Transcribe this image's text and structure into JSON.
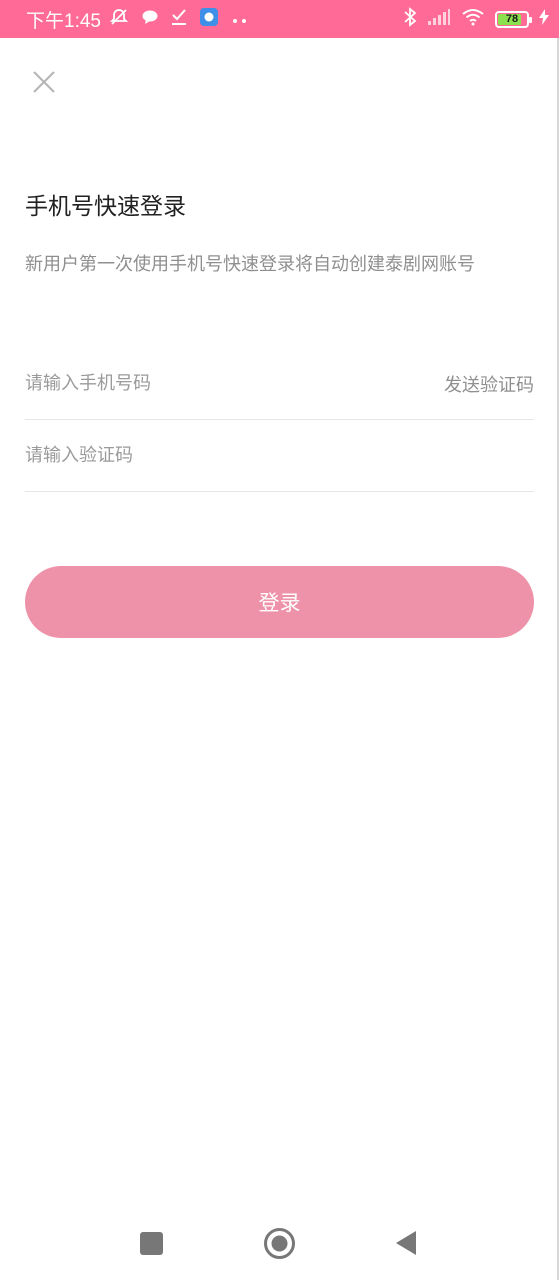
{
  "status_bar": {
    "time": "下午1:45",
    "battery_level": "78",
    "background": "#ff6b96",
    "left_icons": [
      "muted-notification-icon",
      "chat-bubble-icon",
      "download-check-icon",
      "app-badge-icon",
      "more-dots-icon"
    ],
    "right_icons": [
      "bluetooth-icon",
      "signal-icon",
      "wifi-icon",
      "battery-icon",
      "charging-icon"
    ]
  },
  "header": {
    "close_icon": "close-icon"
  },
  "main": {
    "title": "手机号快速登录",
    "subtitle": "新用户第一次使用手机号快速登录将自动创建泰剧网账号",
    "phone_field": {
      "placeholder": "请输入手机号码",
      "value": ""
    },
    "send_code_label": "发送验证码",
    "code_field": {
      "placeholder": "请输入验证码",
      "value": ""
    },
    "login_label": "登录",
    "accent_color": "#ee92a9"
  },
  "nav_bar": {
    "icons": [
      "recent-apps-icon",
      "home-icon",
      "back-icon"
    ]
  }
}
